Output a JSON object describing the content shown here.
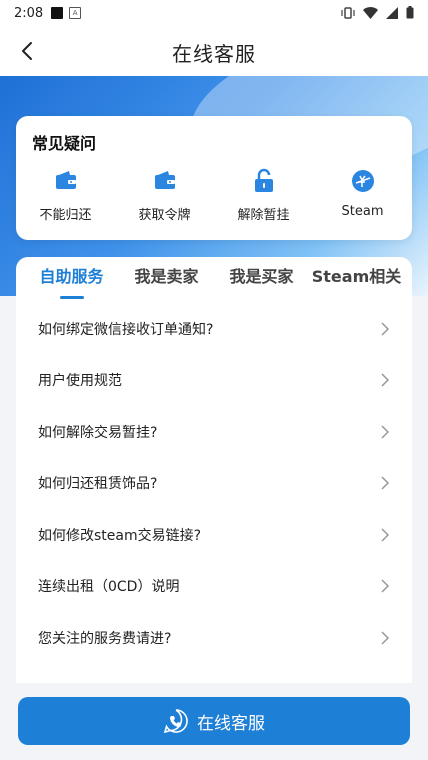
{
  "status_bar": {
    "time": "2:08",
    "badge": "A"
  },
  "header": {
    "title": "在线客服"
  },
  "faq": {
    "title": "常见疑问",
    "items": [
      {
        "label": "不能归还",
        "icon": "wallet-icon"
      },
      {
        "label": "获取令牌",
        "icon": "wallet-icon"
      },
      {
        "label": "解除暂挂",
        "icon": "unlock-icon"
      },
      {
        "label": "Steam",
        "icon": "steam-icon"
      }
    ]
  },
  "tabs": [
    {
      "label": "自助服务",
      "active": true
    },
    {
      "label": "我是卖家",
      "active": false
    },
    {
      "label": "我是买家",
      "active": false
    },
    {
      "label": "Steam相关",
      "active": false
    }
  ],
  "questions": [
    "如何绑定微信接收订单通知?",
    "用户使用规范",
    "如何解除交易暂挂?",
    "如何归还租赁饰品?",
    "如何修改steam交易链接?",
    "连续出租（0CD）说明",
    "您关注的服务费请进?"
  ],
  "bottom_button": {
    "label": "在线客服"
  },
  "colors": {
    "accent": "#1e7fd6",
    "icon_blue": "#2a86e0"
  }
}
